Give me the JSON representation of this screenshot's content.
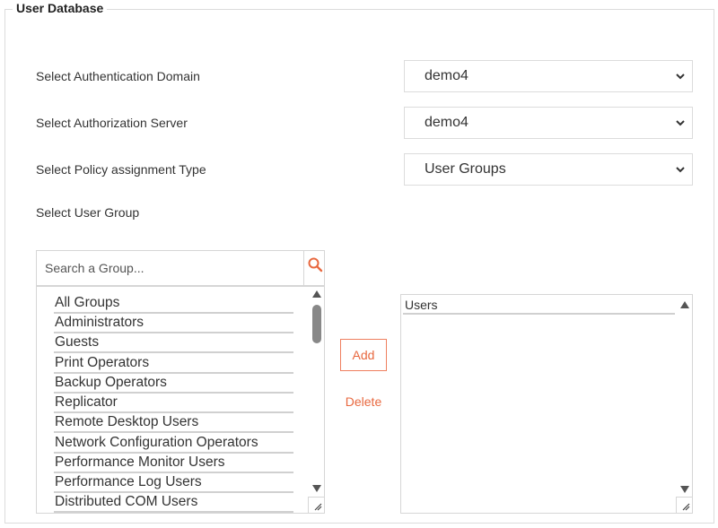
{
  "fieldset": {
    "legend": "User Database"
  },
  "form": {
    "auth_domain": {
      "label": "Select Authentication Domain",
      "value": "demo4"
    },
    "auth_server": {
      "label": "Select Authorization Server",
      "value": "demo4"
    },
    "policy_type": {
      "label": "Select Policy assignment Type",
      "value": "User Groups"
    },
    "user_group_label": "Select User Group"
  },
  "search": {
    "placeholder": "Search a Group...",
    "icon": "search-icon"
  },
  "groups": [
    "All Groups",
    "Administrators",
    "Guests",
    "Print Operators",
    "Backup Operators",
    "Replicator",
    "Remote Desktop Users",
    "Network Configuration Operators",
    "Performance Monitor Users",
    "Performance Log Users",
    "Distributed COM Users"
  ],
  "actions": {
    "add": "Add",
    "delete": "Delete"
  },
  "users_list": {
    "header": "Users"
  },
  "colors": {
    "accent": "#e8683f",
    "border": "#dcdcdc"
  }
}
